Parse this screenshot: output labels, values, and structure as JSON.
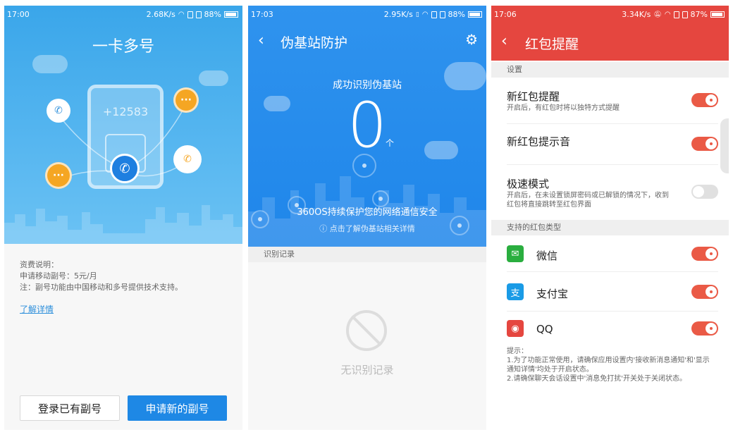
{
  "screen1": {
    "status": {
      "time": "17:00",
      "speed": "2.68K/s",
      "battery": "88%"
    },
    "title": "一卡多号",
    "card_number": "+12583",
    "fee_lines": [
      "资费说明：",
      "申请移动副号：5元/月",
      "注：副号功能由中国移动和多号提供技术支持。"
    ],
    "details_link": "了解详情",
    "login_button": "登录已有副号",
    "apply_button": "申请新的副号",
    "colors": {
      "top_bg": "#3aa6ea",
      "primary_button": "#1e88e5"
    }
  },
  "screen2": {
    "status": {
      "time": "17:03",
      "speed": "2.95K/s",
      "battery": "88%"
    },
    "title": "伪基站防护",
    "subtitle": "成功识别伪基站",
    "count": "0",
    "count_unit": "个",
    "protect_msg": "360OS持续保护您的网络通信安全",
    "info_link": "ⓘ 点击了解伪基站相关详情",
    "section": "识别记录",
    "empty_text": "无识别记录",
    "colors": {
      "top_bg": "#2f93ee"
    }
  },
  "screen3": {
    "status": {
      "time": "17:06",
      "speed": "3.34K/s",
      "battery": "87%"
    },
    "title": "红包提醒",
    "section_settings": "设置",
    "settings": [
      {
        "title": "新红包提醒",
        "desc": "开启后，有红包时将以独特方式提醒",
        "on": true
      },
      {
        "title": "新红包提示音",
        "desc": "",
        "on": true
      },
      {
        "title": "极速模式",
        "desc": "开启后，在未设置锁屏密码或已解锁的情况下，收到红包将直接跳转至红包界面",
        "on": false
      }
    ],
    "section_types": "支持的红包类型",
    "apps": [
      {
        "name": "微信",
        "icon": "wechat-icon",
        "color": "#2aae3f",
        "on": true
      },
      {
        "name": "支付宝",
        "icon": "alipay-icon",
        "color": "#1a9be6",
        "on": true
      },
      {
        "name": "QQ",
        "icon": "qq-icon",
        "color": "#e5463f",
        "on": true
      }
    ],
    "tip_lines": [
      "提示：",
      "1.为了功能正常使用，请确保应用设置内'接收新消息通知'和'显示通知详情'均处于开启状态。",
      "2.请确保聊天会话设置中'消息免打扰'开关处于关闭状态。"
    ],
    "colors": {
      "header_bg": "#e5463f",
      "toggle_on": "#ea5a46"
    }
  }
}
